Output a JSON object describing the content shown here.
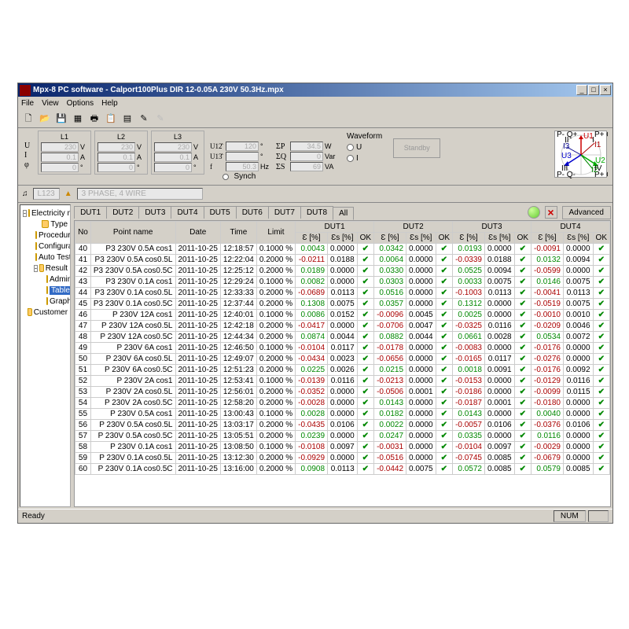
{
  "title": "Mpx-8 PC software - Calport100Plus DIR 12-0.05A 230V 50.3Hz.mpx",
  "menu": [
    "File",
    "View",
    "Options",
    "Help"
  ],
  "phases": {
    "labels": [
      "U",
      "I",
      "φ"
    ],
    "units": [
      "V",
      "A",
      "°"
    ],
    "L1": {
      "U": "230",
      "I": "0.1",
      "phi": "0"
    },
    "L2": {
      "U": "230",
      "I": "0.1",
      "phi": "0"
    },
    "L3": {
      "U": "230",
      "I": "0.1",
      "phi": "0"
    }
  },
  "mid": {
    "U12": "120",
    "U12u": "°",
    "U13": "",
    "U13u": "°",
    "f": "50.3",
    "fu": "Hz",
    "synch": "Synch"
  },
  "sums": {
    "SP": "34.5",
    "SPu": "W",
    "SQ": "0",
    "SQu": "Var",
    "SS": "69",
    "SSu": "VA"
  },
  "waveform": {
    "title": "Waveform",
    "U": "U",
    "I": "I"
  },
  "standby": "Standby",
  "vector_labels": {
    "tl": "P- Q+",
    "tr": "P+ Q+",
    "bl": "P- Q-",
    "br": "P+ Q-",
    "I": "I",
    "II": "II",
    "III": "III",
    "IV": "IV"
  },
  "status_info": {
    "hp": "",
    "l": "L123",
    "alert": "",
    "mode": "3 PHASE, 4 WIRE"
  },
  "tree": [
    {
      "lvl": 0,
      "exp": "-",
      "label": "Electricity meter"
    },
    {
      "lvl": 1,
      "exp": "",
      "label": "Type"
    },
    {
      "lvl": 1,
      "exp": "",
      "label": "Procedure"
    },
    {
      "lvl": 1,
      "exp": "",
      "label": "Configuration"
    },
    {
      "lvl": 1,
      "exp": "",
      "label": "Auto Test"
    },
    {
      "lvl": 1,
      "exp": "-",
      "label": "Result"
    },
    {
      "lvl": 2,
      "exp": "",
      "label": "Admin"
    },
    {
      "lvl": 2,
      "exp": "",
      "label": "Table",
      "sel": true
    },
    {
      "lvl": 2,
      "exp": "",
      "label": "Graphic"
    },
    {
      "lvl": 0,
      "exp": "",
      "label": "Customer"
    }
  ],
  "tabs": [
    "DUT1",
    "DUT2",
    "DUT3",
    "DUT4",
    "DUT5",
    "DUT6",
    "DUT7",
    "DUT8",
    "All"
  ],
  "active_tab": "All",
  "advanced": "Advanced",
  "cols": [
    "No",
    "Point name",
    "Date",
    "Time",
    "Limit"
  ],
  "dut_cols": [
    "Ɛ [%]",
    "Ɛs [%]",
    "OK"
  ],
  "duts": [
    "DUT1",
    "DUT2",
    "DUT3",
    "DUT4"
  ],
  "rows": [
    {
      "no": 40,
      "name": "P3 230V 0.5A cos1",
      "date": "2011-10-25",
      "time": "12:18:57",
      "limit": "0.1000 %",
      "d": [
        [
          "0.0043",
          "0.0000"
        ],
        [
          "0.0342",
          "0.0000"
        ],
        [
          "0.0193",
          "0.0000"
        ],
        [
          "-0.0091",
          "0.0000"
        ]
      ]
    },
    {
      "no": 41,
      "name": "P3 230V 0.5A cos0.5L",
      "date": "2011-10-25",
      "time": "12:22:04",
      "limit": "0.2000 %",
      "d": [
        [
          "-0.0211",
          "0.0188"
        ],
        [
          "0.0064",
          "0.0000"
        ],
        [
          "-0.0339",
          "0.0188"
        ],
        [
          "0.0132",
          "0.0094"
        ]
      ]
    },
    {
      "no": 42,
      "name": "P3 230V 0.5A cos0.5C",
      "date": "2011-10-25",
      "time": "12:25:12",
      "limit": "0.2000 %",
      "d": [
        [
          "0.0189",
          "0.0000"
        ],
        [
          "0.0330",
          "0.0000"
        ],
        [
          "0.0525",
          "0.0094"
        ],
        [
          "-0.0599",
          "0.0000"
        ]
      ]
    },
    {
      "no": 43,
      "name": "P3 230V 0.1A cos1",
      "date": "2011-10-25",
      "time": "12:29:24",
      "limit": "0.1000 %",
      "d": [
        [
          "0.0082",
          "0.0000"
        ],
        [
          "0.0303",
          "0.0000"
        ],
        [
          "0.0033",
          "0.0075"
        ],
        [
          "0.0146",
          "0.0075"
        ]
      ]
    },
    {
      "no": 44,
      "name": "P3 230V 0.1A cos0.5L",
      "date": "2011-10-25",
      "time": "12:33:33",
      "limit": "0.2000 %",
      "d": [
        [
          "-0.0689",
          "0.0113"
        ],
        [
          "0.0516",
          "0.0000"
        ],
        [
          "-0.1003",
          "0.0113"
        ],
        [
          "-0.0041",
          "0.0113"
        ]
      ]
    },
    {
      "no": 45,
      "name": "P3 230V 0.1A cos0.5C",
      "date": "2011-10-25",
      "time": "12:37:44",
      "limit": "0.2000 %",
      "d": [
        [
          "0.1308",
          "0.0075"
        ],
        [
          "0.0357",
          "0.0000"
        ],
        [
          "0.1312",
          "0.0000"
        ],
        [
          "-0.0519",
          "0.0075"
        ]
      ]
    },
    {
      "no": 46,
      "name": "P 230V 12A cos1",
      "date": "2011-10-25",
      "time": "12:40:01",
      "limit": "0.1000 %",
      "d": [
        [
          "0.0086",
          "0.0152"
        ],
        [
          "-0.0096",
          "0.0045"
        ],
        [
          "0.0025",
          "0.0000"
        ],
        [
          "-0.0010",
          "0.0010"
        ]
      ]
    },
    {
      "no": 47,
      "name": "P 230V 12A cos0.5L",
      "date": "2011-10-25",
      "time": "12:42:18",
      "limit": "0.2000 %",
      "d": [
        [
          "-0.0417",
          "0.0000"
        ],
        [
          "-0.0706",
          "0.0047"
        ],
        [
          "-0.0325",
          "0.0116"
        ],
        [
          "-0.0209",
          "0.0046"
        ]
      ]
    },
    {
      "no": 48,
      "name": "P 230V 12A cos0.5C",
      "date": "2011-10-25",
      "time": "12:44:34",
      "limit": "0.2000 %",
      "d": [
        [
          "0.0874",
          "0.0044"
        ],
        [
          "0.0882",
          "0.0044"
        ],
        [
          "0.0661",
          "0.0028"
        ],
        [
          "0.0534",
          "0.0072"
        ]
      ]
    },
    {
      "no": 49,
      "name": "P 230V 6A cos1",
      "date": "2011-10-25",
      "time": "12:46:50",
      "limit": "0.1000 %",
      "d": [
        [
          "-0.0104",
          "0.0117"
        ],
        [
          "-0.0178",
          "0.0000"
        ],
        [
          "-0.0083",
          "0.0000"
        ],
        [
          "-0.0176",
          "0.0000"
        ]
      ]
    },
    {
      "no": 50,
      "name": "P 230V 6A cos0.5L",
      "date": "2011-10-25",
      "time": "12:49:07",
      "limit": "0.2000 %",
      "d": [
        [
          "-0.0434",
          "0.0023"
        ],
        [
          "-0.0656",
          "0.0000"
        ],
        [
          "-0.0165",
          "0.0117"
        ],
        [
          "-0.0276",
          "0.0000"
        ]
      ]
    },
    {
      "no": 51,
      "name": "P 230V 6A cos0.5C",
      "date": "2011-10-25",
      "time": "12:51:23",
      "limit": "0.2000 %",
      "d": [
        [
          "0.0225",
          "0.0026"
        ],
        [
          "0.0215",
          "0.0000"
        ],
        [
          "0.0018",
          "0.0091"
        ],
        [
          "-0.0176",
          "0.0092"
        ]
      ]
    },
    {
      "no": 52,
      "name": "P 230V 2A cos1",
      "date": "2011-10-25",
      "time": "12:53:41",
      "limit": "0.1000 %",
      "d": [
        [
          "-0.0139",
          "0.0116"
        ],
        [
          "-0.0213",
          "0.0000"
        ],
        [
          "-0.0153",
          "0.0000"
        ],
        [
          "-0.0129",
          "0.0116"
        ]
      ]
    },
    {
      "no": 53,
      "name": "P 230V 2A cos0.5L",
      "date": "2011-10-25",
      "time": "12:56:01",
      "limit": "0.2000 %",
      "d": [
        [
          "-0.0352",
          "0.0000"
        ],
        [
          "-0.0506",
          "0.0001"
        ],
        [
          "-0.0186",
          "0.0000"
        ],
        [
          "-0.0099",
          "0.0115"
        ]
      ]
    },
    {
      "no": 54,
      "name": "P 230V 2A cos0.5C",
      "date": "2011-10-25",
      "time": "12:58:20",
      "limit": "0.2000 %",
      "d": [
        [
          "-0.0028",
          "0.0000"
        ],
        [
          "0.0143",
          "0.0000"
        ],
        [
          "-0.0187",
          "0.0001"
        ],
        [
          "-0.0180",
          "0.0000"
        ]
      ]
    },
    {
      "no": 55,
      "name": "P 230V 0.5A cos1",
      "date": "2011-10-25",
      "time": "13:00:43",
      "limit": "0.1000 %",
      "d": [
        [
          "0.0028",
          "0.0000"
        ],
        [
          "0.0182",
          "0.0000"
        ],
        [
          "0.0143",
          "0.0000"
        ],
        [
          "0.0040",
          "0.0000"
        ]
      ]
    },
    {
      "no": 56,
      "name": "P 230V 0.5A cos0.5L",
      "date": "2011-10-25",
      "time": "13:03:17",
      "limit": "0.2000 %",
      "d": [
        [
          "-0.0435",
          "0.0106"
        ],
        [
          "0.0022",
          "0.0000"
        ],
        [
          "-0.0057",
          "0.0106"
        ],
        [
          "-0.0376",
          "0.0106"
        ]
      ]
    },
    {
      "no": 57,
      "name": "P 230V 0.5A cos0.5C",
      "date": "2011-10-25",
      "time": "13:05:51",
      "limit": "0.2000 %",
      "d": [
        [
          "0.0239",
          "0.0000"
        ],
        [
          "0.0247",
          "0.0000"
        ],
        [
          "0.0335",
          "0.0000"
        ],
        [
          "0.0116",
          "0.0000"
        ]
      ]
    },
    {
      "no": 58,
      "name": "P 230V 0.1A cos1",
      "date": "2011-10-25",
      "time": "13:08:50",
      "limit": "0.1000 %",
      "d": [
        [
          "-0.0108",
          "0.0097"
        ],
        [
          "-0.0031",
          "0.0000"
        ],
        [
          "-0.0104",
          "0.0097"
        ],
        [
          "-0.0029",
          "0.0000"
        ]
      ]
    },
    {
      "no": 59,
      "name": "P 230V 0.1A cos0.5L",
      "date": "2011-10-25",
      "time": "13:12:30",
      "limit": "0.2000 %",
      "d": [
        [
          "-0.0929",
          "0.0000"
        ],
        [
          "-0.0516",
          "0.0000"
        ],
        [
          "-0.0745",
          "0.0085"
        ],
        [
          "-0.0679",
          "0.0000"
        ]
      ]
    },
    {
      "no": 60,
      "name": "P 230V 0.1A cos0.5C",
      "date": "2011-10-25",
      "time": "13:16:00",
      "limit": "0.2000 %",
      "d": [
        [
          "0.0908",
          "0.0113"
        ],
        [
          "-0.0442",
          "0.0075"
        ],
        [
          "0.0572",
          "0.0085"
        ],
        [
          "0.0579",
          "0.0085"
        ]
      ]
    }
  ],
  "status": {
    "ready": "Ready",
    "num": "NUM"
  }
}
